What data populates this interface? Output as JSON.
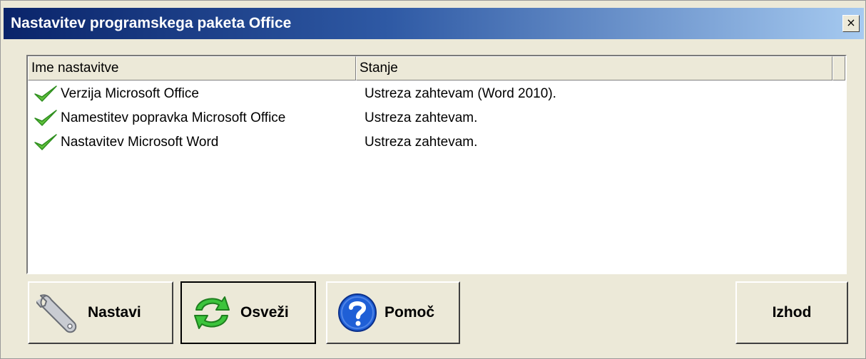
{
  "window": {
    "title": "Nastavitev programskega paketa Office",
    "close_glyph": "×"
  },
  "list": {
    "columns": [
      "Ime nastavitve",
      "Stanje"
    ],
    "rows": [
      {
        "icon": "checkmark-icon",
        "name": "Verzija Microsoft Office",
        "status": "Ustreza zahtevam (Word 2010)."
      },
      {
        "icon": "checkmark-icon",
        "name": "Namestitev popravka Microsoft Office",
        "status": "Ustreza zahtevam."
      },
      {
        "icon": "checkmark-icon",
        "name": "Nastavitev Microsoft Word",
        "status": "Ustreza zahtevam."
      }
    ]
  },
  "buttons": {
    "setup": {
      "label": "Nastavi",
      "icon": "wrench-icon"
    },
    "refresh": {
      "label": "Osveži",
      "icon": "refresh-icon"
    },
    "help": {
      "label": "Pomoč",
      "icon": "help-icon"
    },
    "exit": {
      "label": "Izhod"
    }
  },
  "colors": {
    "check": "#5fbf3b",
    "refresh": "#3cc43c",
    "help": "#1f5fd6"
  }
}
